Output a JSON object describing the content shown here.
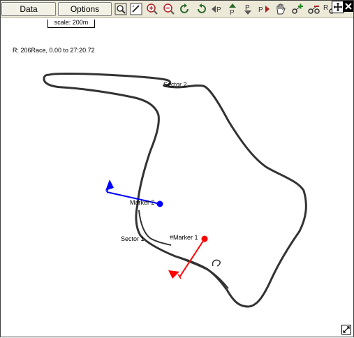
{
  "toolbar": {
    "data_label": "Data",
    "options_label": "Options",
    "icons": [
      "zoom-extents-icon",
      "zoom-box-icon",
      "zoom-in-icon",
      "zoom-out-icon",
      "rotate-cw-icon",
      "rotate-ccw-icon",
      "prev-marker-icon",
      "up-marker-icon",
      "down-marker-icon",
      "next-marker-icon",
      "pan-hand-icon",
      "add-marker-icon",
      "remove-marker-icon",
      "marker-options-icon",
      "move-icon",
      "close-icon"
    ]
  },
  "map": {
    "scale_label": "scale: 200m",
    "run_info": "R: 206Race, 0.00 to 27:20.72",
    "labels": {
      "sector2": "Sector 2",
      "sector1": "Sector 1",
      "marker2": "Marker 2",
      "marker1": "#Marker 1"
    },
    "colors": {
      "track": "#333333",
      "marker1": "#ff0000",
      "marker2": "#0000ff"
    }
  }
}
